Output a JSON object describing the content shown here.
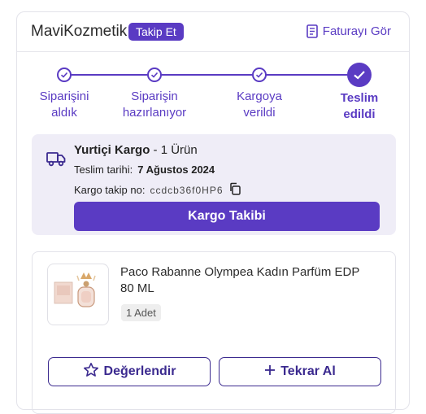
{
  "header": {
    "seller_name": "MaviKozmetik",
    "follow_label": "Takip Et",
    "invoice_label": "Faturayı Gör"
  },
  "steps": [
    {
      "line1": "Siparişini",
      "line2": "aldık",
      "state": "done"
    },
    {
      "line1": "Siparişin",
      "line2": "hazırlanıyor",
      "state": "done"
    },
    {
      "line1": "Kargoya",
      "line2": "verildi",
      "state": "done"
    },
    {
      "line1": "Teslim",
      "line2": "edildi",
      "state": "current"
    }
  ],
  "shipping": {
    "carrier": "Yurtiçi Kargo",
    "item_count": "- 1 Ürün",
    "delivery_label": "Teslim tarihi:",
    "delivery_date": "7 Ağustos 2024",
    "tracking_label": "Kargo takip no:",
    "tracking_code": "ccdcb36f0HP6",
    "track_button": "Kargo Takibi"
  },
  "product": {
    "title": "Paco Rabanne Olympea Kadın Parfüm EDP 80 ML",
    "quantity": "1 Adet",
    "review_button": "Değerlendir",
    "reorder_button": "Tekrar Al"
  },
  "colors": {
    "accent": "#5a3bc3",
    "accent_dark": "#3b2a8f",
    "panel_bg": "#efedf7"
  }
}
